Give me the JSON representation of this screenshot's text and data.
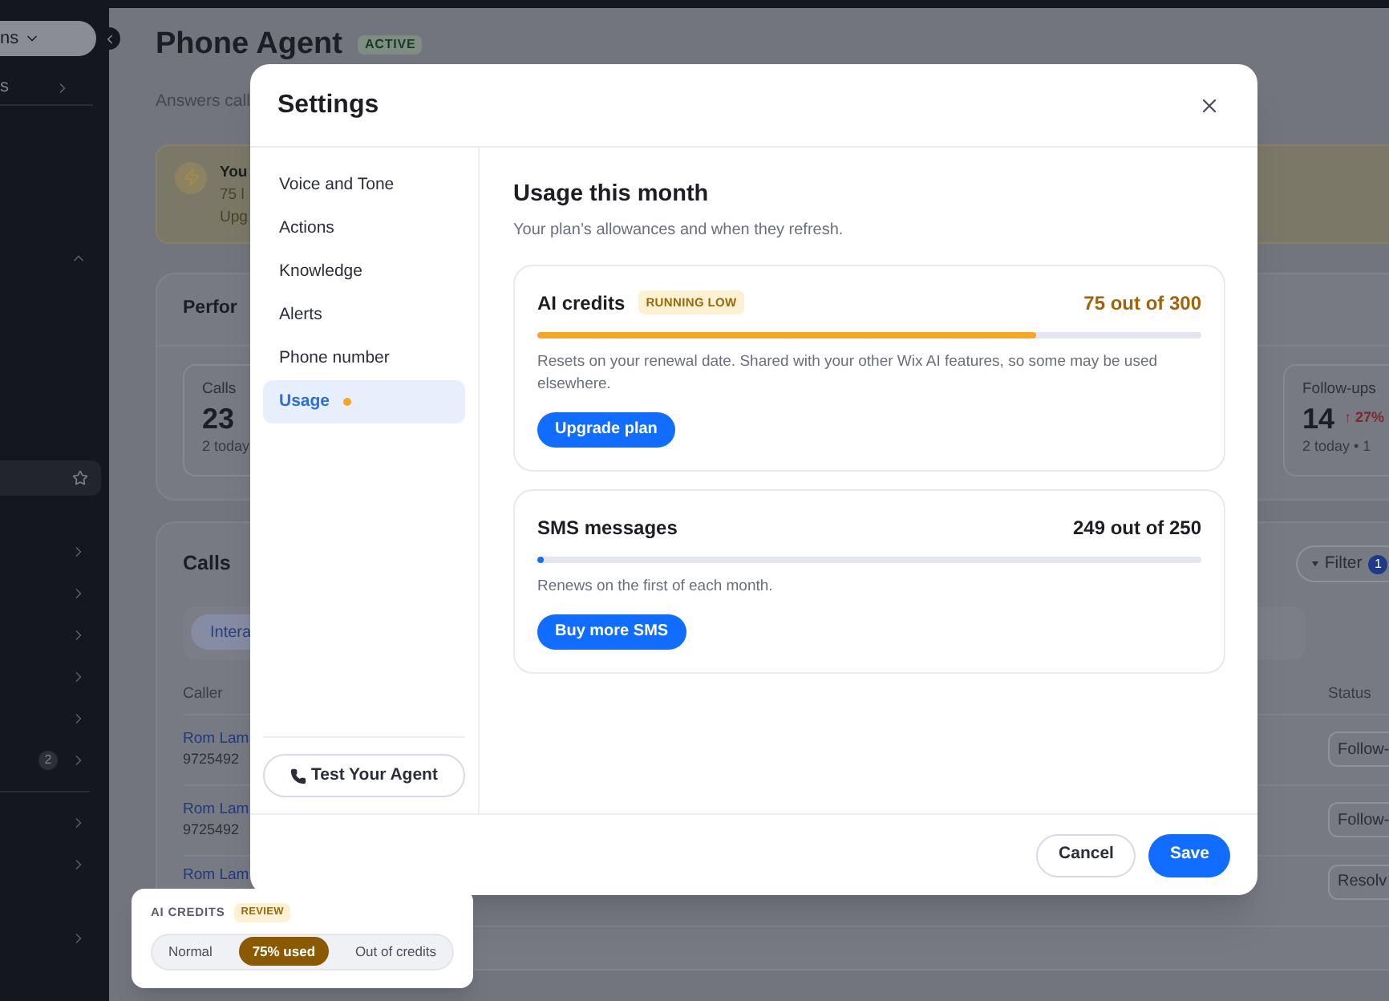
{
  "sidebar": {
    "workspace_button": "ns",
    "top_link": "s",
    "badge": "2"
  },
  "page": {
    "title": "Phone Agent",
    "status_badge": "ACTIVE",
    "subtitle": "Answers call",
    "banner": {
      "title": "You",
      "line_1": "75 l",
      "line_2": "Upg"
    },
    "performance": {
      "title": "Perfor",
      "stats": [
        {
          "label": "Calls",
          "value": "23",
          "detail": "2 today"
        },
        {
          "label": "Follow-ups",
          "value": "14",
          "change": "↑ 27%",
          "detail": "2 today • 1"
        }
      ]
    },
    "calls": {
      "title": "Calls",
      "filter": {
        "label": "Filter",
        "count": "1"
      },
      "tabs": [
        {
          "label": "Intera",
          "selected": true
        }
      ],
      "columns": [
        "Caller",
        "Status"
      ],
      "rows": [
        {
          "caller": "Rom Lam",
          "phone": "9725492",
          "status": "Follow-"
        },
        {
          "caller": "Rom Lam",
          "phone": "9725492",
          "status": "Follow-"
        },
        {
          "caller": "Rom Lam",
          "status": "Resolv"
        }
      ]
    }
  },
  "modal": {
    "title": "Settings",
    "nav": [
      {
        "label": "Voice and Tone",
        "selected": false,
        "alert": false
      },
      {
        "label": "Actions",
        "selected": false,
        "alert": false
      },
      {
        "label": "Knowledge",
        "selected": false,
        "alert": false
      },
      {
        "label": "Alerts",
        "selected": false,
        "alert": false
      },
      {
        "label": "Phone number",
        "selected": false,
        "alert": false
      },
      {
        "label": "Usage",
        "selected": true,
        "alert": true
      }
    ],
    "test_button": "Test Your Agent",
    "heading": "Usage this month",
    "subheading": "Your plan’s allowances and when they refresh.",
    "meters": [
      {
        "name": "AI credits",
        "badge": "RUNNING LOW",
        "warning": true,
        "reading": "75 out of 300",
        "level": 0.75,
        "note": "Resets on your renewal date. Shared with your other Wix AI features, so some may be used elsewhere.",
        "action": "Upgrade plan"
      },
      {
        "name": "SMS messages",
        "warning": false,
        "reading": "249 out of 250",
        "level": 0.004,
        "note": "Renews on the first of each month.",
        "action": "Buy more SMS"
      }
    ],
    "buttons": {
      "cancel": "Cancel",
      "save": "Save"
    }
  },
  "ai_credits_panel": {
    "title": "AI CREDITS",
    "badge": "REVIEW",
    "options": [
      {
        "label": "Normal",
        "selected": false
      },
      {
        "label": "75% used",
        "selected": true
      },
      {
        "label": "Out of credits",
        "selected": false
      }
    ]
  }
}
